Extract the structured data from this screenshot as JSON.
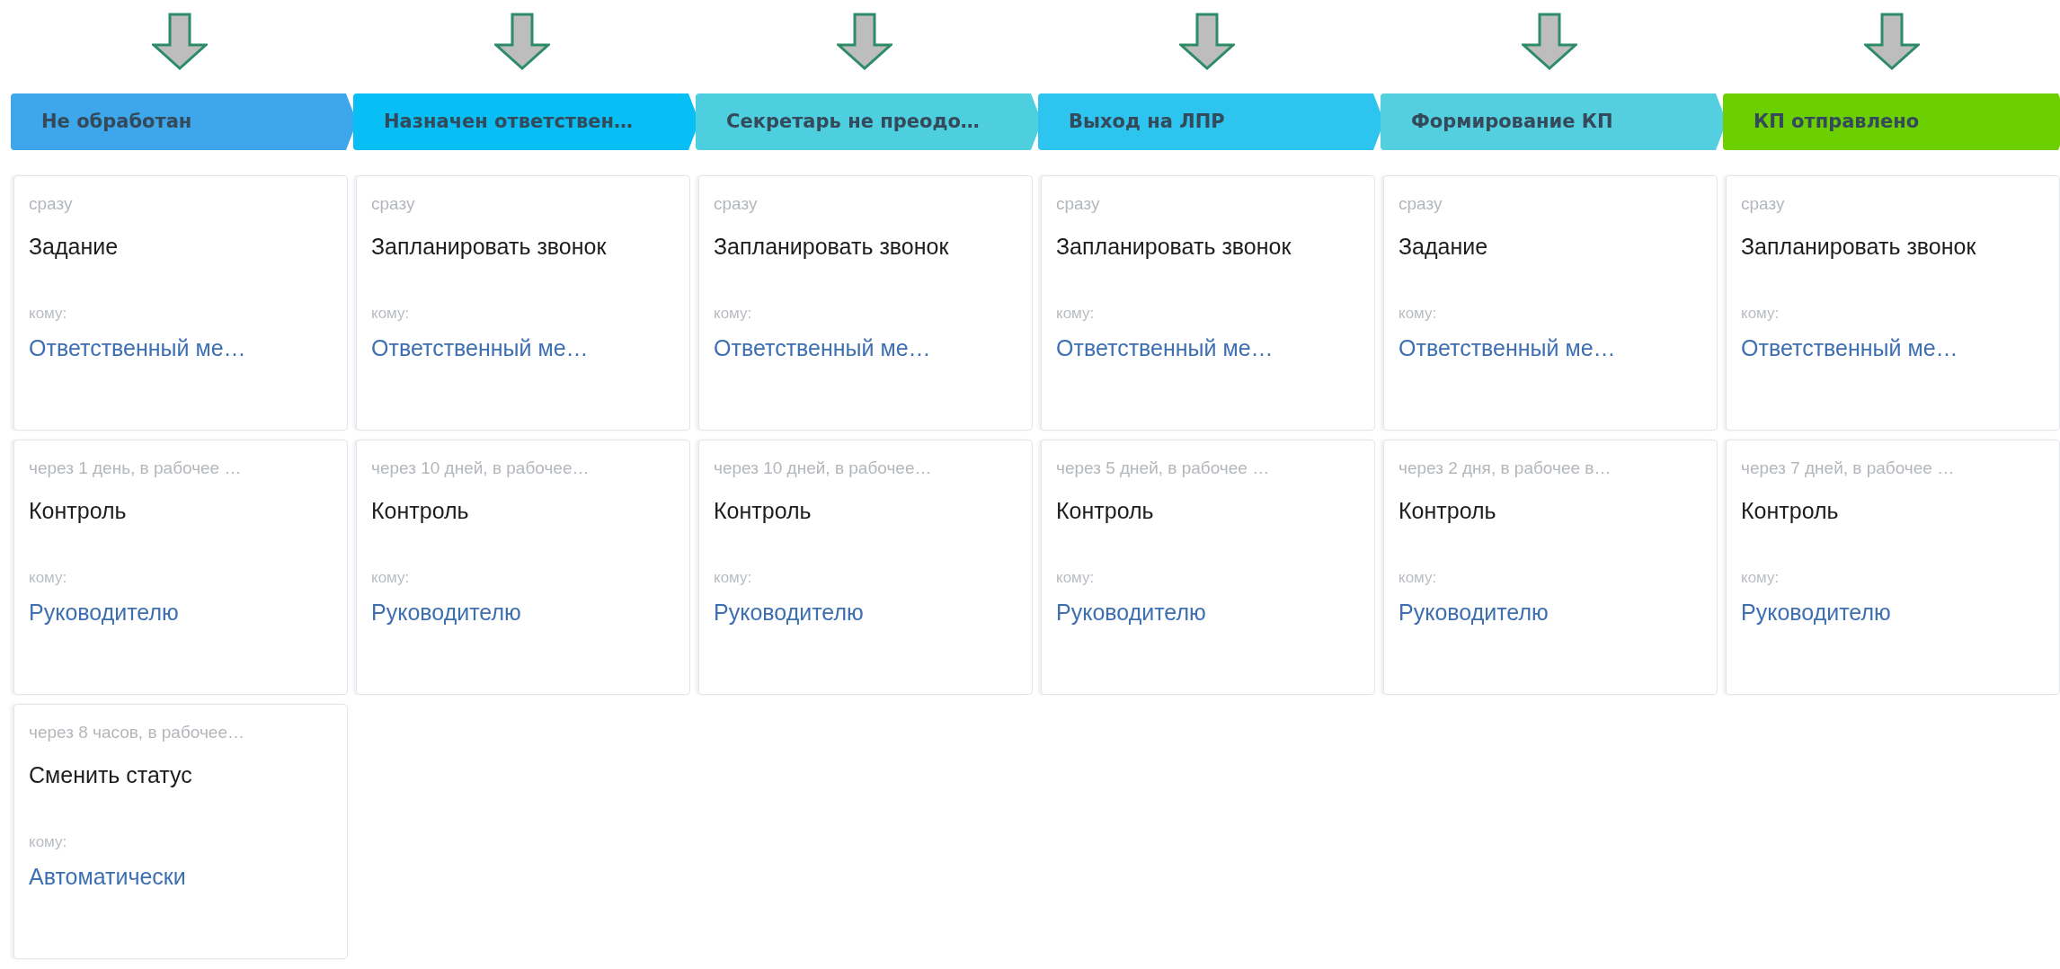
{
  "stages": [
    {
      "label": "Не обработан",
      "color": "#3ea6ea",
      "cards": [
        {
          "timing": "сразу",
          "action": "Задание",
          "to_label": "кому:",
          "assignee": "Ответственный ме…"
        },
        {
          "timing": "через 1 день, в рабочее …",
          "action": "Контроль",
          "to_label": "кому:",
          "assignee": "Руководителю"
        },
        {
          "timing": "через 8 часов, в рабочее…",
          "action": "Сменить статус",
          "to_label": "кому:",
          "assignee": "Автоматически"
        }
      ]
    },
    {
      "label": "Назначен ответствен…",
      "color": "#07bff5",
      "cards": [
        {
          "timing": "сразу",
          "action": "Запланировать звонок",
          "to_label": "кому:",
          "assignee": "Ответственный ме…"
        },
        {
          "timing": "через 10 дней, в рабочее…",
          "action": "Контроль",
          "to_label": "кому:",
          "assignee": "Руководителю"
        }
      ]
    },
    {
      "label": "Секретарь не преодо…",
      "color": "#4ecfe0",
      "cards": [
        {
          "timing": "сразу",
          "action": "Запланировать звонок",
          "to_label": "кому:",
          "assignee": "Ответственный ме…"
        },
        {
          "timing": "через 10 дней, в рабочее…",
          "action": "Контроль",
          "to_label": "кому:",
          "assignee": "Руководителю"
        }
      ]
    },
    {
      "label": "Выход на ЛПР",
      "color": "#2ec4f0",
      "cards": [
        {
          "timing": "сразу",
          "action": "Запланировать звонок",
          "to_label": "кому:",
          "assignee": "Ответственный ме…"
        },
        {
          "timing": "через 5 дней, в рабочее …",
          "action": "Контроль",
          "to_label": "кому:",
          "assignee": "Руководителю"
        }
      ]
    },
    {
      "label": "Формирование КП",
      "color": "#54cfe0",
      "cards": [
        {
          "timing": "сразу",
          "action": "Задание",
          "to_label": "кому:",
          "assignee": "Ответственный ме…"
        },
        {
          "timing": "через 2 дня, в рабочее в…",
          "action": "Контроль",
          "to_label": "кому:",
          "assignee": "Руководителю"
        }
      ]
    },
    {
      "label": "КП отправлено",
      "color": "#6cd000",
      "cards": [
        {
          "timing": "сразу",
          "action": "Запланировать звонок",
          "to_label": "кому:",
          "assignee": "Ответственный ме…"
        },
        {
          "timing": "через 7 дней, в рабочее …",
          "action": "Контроль",
          "to_label": "кому:",
          "assignee": "Руководителю"
        }
      ]
    }
  ]
}
